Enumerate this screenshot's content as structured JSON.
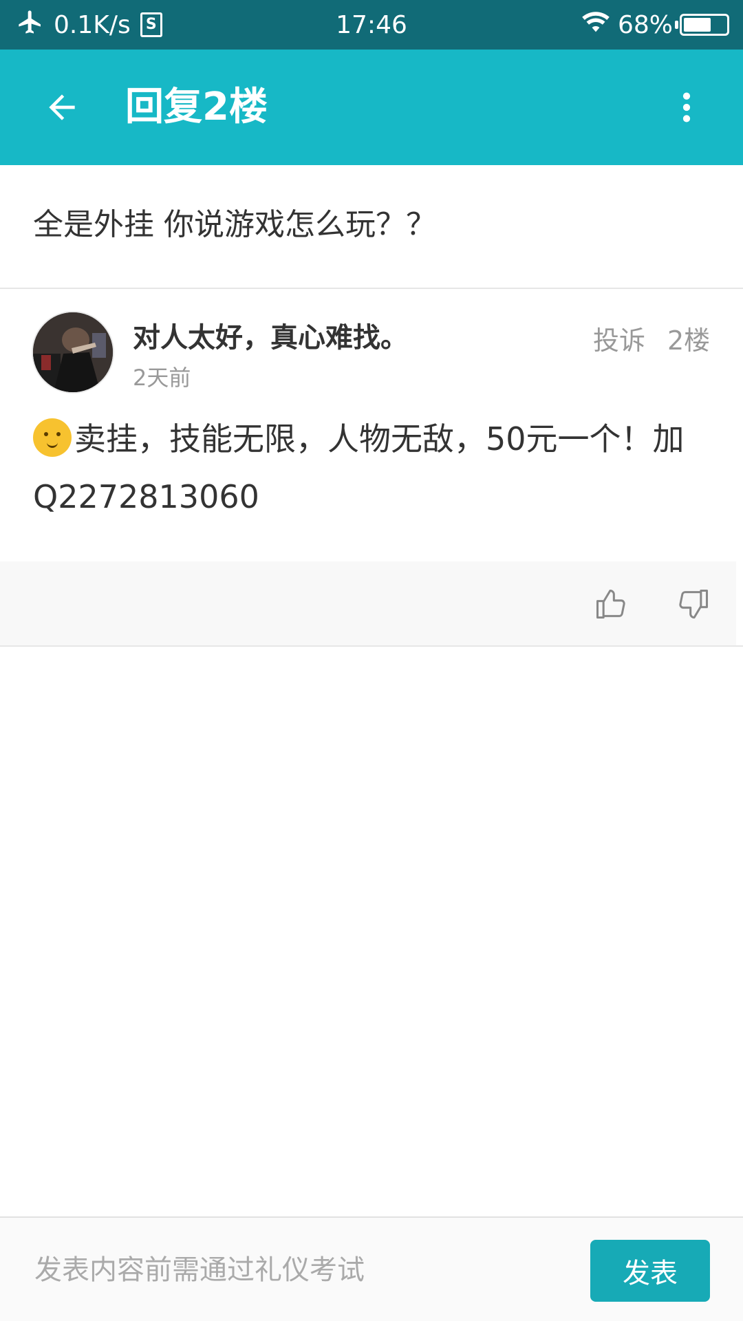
{
  "status_bar": {
    "network_speed": "0.1K/s",
    "sim_label": "S",
    "time": "17:46",
    "battery_percent": "68%",
    "battery_level": 0.68
  },
  "app_bar": {
    "title": "回复2楼"
  },
  "post": {
    "text": "全是外挂 你说游戏怎么玩？？"
  },
  "reply": {
    "user_name": "对人太好，真心难找。",
    "time": "2天前",
    "report_label": "投诉",
    "floor_label": "2楼",
    "content_line1": "卖挂，技能无限，人物无敌，50元一个！加",
    "content_line2": "Q2272813060"
  },
  "bottom_bar": {
    "input_placeholder": "发表内容前需通过礼仪考试",
    "publish_label": "发表"
  },
  "colors": {
    "status_bar": "#116b77",
    "app_bar": "#17b8c6",
    "publish_button": "#17aab6"
  }
}
